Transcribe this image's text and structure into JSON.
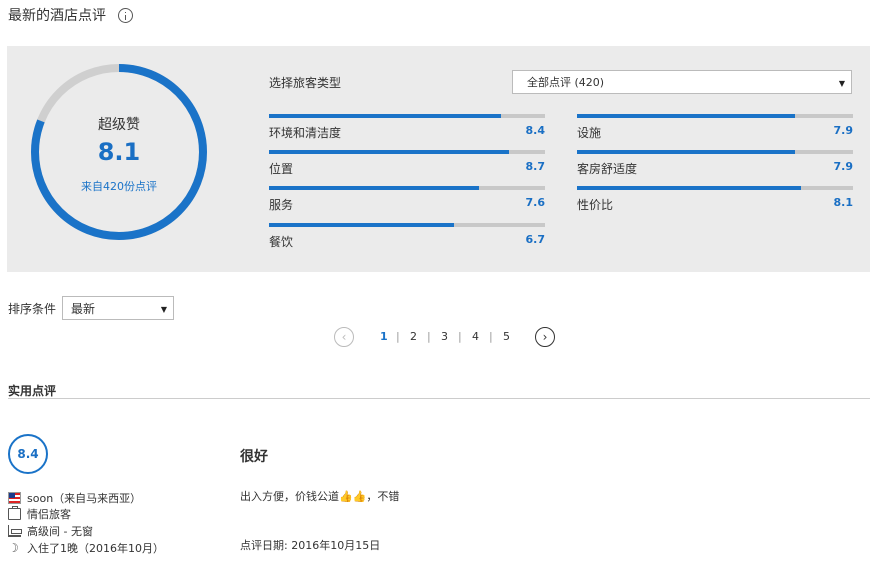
{
  "header": {
    "title": "最新的酒店点评"
  },
  "overall": {
    "rating_word": "超级赞",
    "score": "8.1",
    "score_fraction": 0.81,
    "review_count_text": "来自420份点评"
  },
  "traveler_filter": {
    "label": "选择旅客类型",
    "selected": "全部点评 (420)"
  },
  "categories": [
    {
      "label": "环境和清洁度",
      "value": "8.4"
    },
    {
      "label": "位置",
      "value": "8.7"
    },
    {
      "label": "服务",
      "value": "7.6"
    },
    {
      "label": "餐饮",
      "value": "6.7"
    },
    {
      "label": "设施",
      "value": "7.9"
    },
    {
      "label": "客房舒适度",
      "value": "7.9"
    },
    {
      "label": "性价比",
      "value": "8.1"
    }
  ],
  "sort": {
    "label": "排序条件",
    "selected": "最新"
  },
  "pagination": {
    "pages": [
      "1",
      "2",
      "3",
      "4",
      "5"
    ],
    "current": "1"
  },
  "section": {
    "title": "实用点评"
  },
  "review": {
    "score": "8.4",
    "reviewer": "soon（来自马来西亚）",
    "traveler_type": "情侣旅客",
    "room": "高级间 - 无窗",
    "stay": "入住了1晚（2016年10月）",
    "title": "很好",
    "body": "出入方便，价钱公道👍👍，不错",
    "date": "点评日期: 2016年10月15日"
  },
  "colors": {
    "accent": "#1a73c8",
    "track": "#c8c8c8",
    "panel_bg": "#ebebeb"
  },
  "icons": [
    "info-icon",
    "chevron-down-icon",
    "chevron-left-icon",
    "chevron-right-icon",
    "flag-icon",
    "briefcase-icon",
    "bed-icon",
    "moon-icon"
  ]
}
